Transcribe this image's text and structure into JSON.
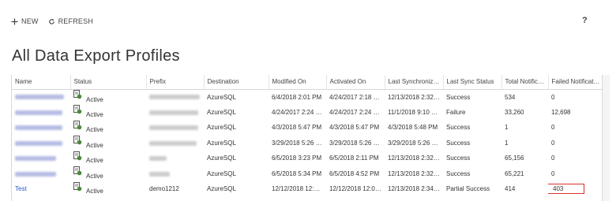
{
  "toolbar": {
    "new_label": "NEW",
    "refresh_label": "REFRESH",
    "help_label": "?"
  },
  "page_title": "All Data Export Profiles",
  "table": {
    "columns": [
      "Name",
      "Status",
      "Prefix",
      "Destination",
      "Modified On",
      "Activated On",
      "Last Synchronize...",
      "Last Sync Status",
      "Total Notificat...",
      "Failed Notificati..."
    ],
    "rows": [
      {
        "name": "",
        "status": "Active",
        "prefix": "",
        "destination": "AzureSQL",
        "modified_on": "6/4/2018 2:01 PM",
        "activated_on": "4/24/2017 2:18 PM",
        "last_sync": "12/13/2018 2:32 ...",
        "last_sync_status": "Success",
        "total": "534",
        "failed": "0"
      },
      {
        "name": "",
        "status": "Active",
        "prefix": "",
        "destination": "AzureSQL",
        "modified_on": "4/24/2017 2:24 PM",
        "activated_on": "4/24/2017 2:24 PM",
        "last_sync": "11/1/2018 9:10 PM",
        "last_sync_status": "Failure",
        "total": "33,260",
        "failed": "12,698"
      },
      {
        "name": "",
        "status": "Active",
        "prefix": "",
        "destination": "AzureSQL",
        "modified_on": "4/3/2018 5:47 PM",
        "activated_on": "4/3/2018 5:47 PM",
        "last_sync": "4/3/2018 5:48 PM",
        "last_sync_status": "Success",
        "total": "1",
        "failed": "0"
      },
      {
        "name": "",
        "status": "Active",
        "prefix": "",
        "destination": "AzureSQL",
        "modified_on": "3/29/2018 5:26 PM",
        "activated_on": "3/29/2018 5:26 PM",
        "last_sync": "3/29/2018 5:26 PM",
        "last_sync_status": "Success",
        "total": "1",
        "failed": "0"
      },
      {
        "name": "",
        "status": "Active",
        "prefix": "",
        "destination": "AzureSQL",
        "modified_on": "6/5/2018 3:23 PM",
        "activated_on": "6/5/2018 2:11 PM",
        "last_sync": "12/13/2018 2:32 ...",
        "last_sync_status": "Success",
        "total": "65,156",
        "failed": "0"
      },
      {
        "name": "",
        "status": "Active",
        "prefix": "",
        "destination": "AzureSQL",
        "modified_on": "6/5/2018 5:34 PM",
        "activated_on": "6/5/2018 4:52 PM",
        "last_sync": "12/13/2018 2:32 ...",
        "last_sync_status": "Success",
        "total": "65,221",
        "failed": "0"
      },
      {
        "name": "Test",
        "status": "Active",
        "prefix": "demo1212",
        "destination": "AzureSQL",
        "modified_on": "12/12/2018 12:02...",
        "activated_on": "12/12/2018 12:02...",
        "last_sync": "12/13/2018 2:34 ...",
        "last_sync_status": "Partial Success",
        "total": "414",
        "failed": "403"
      }
    ]
  },
  "colors": {
    "link": "#2b57c2",
    "highlight": "#d9302c",
    "status_icon": "#4a8a3a"
  }
}
